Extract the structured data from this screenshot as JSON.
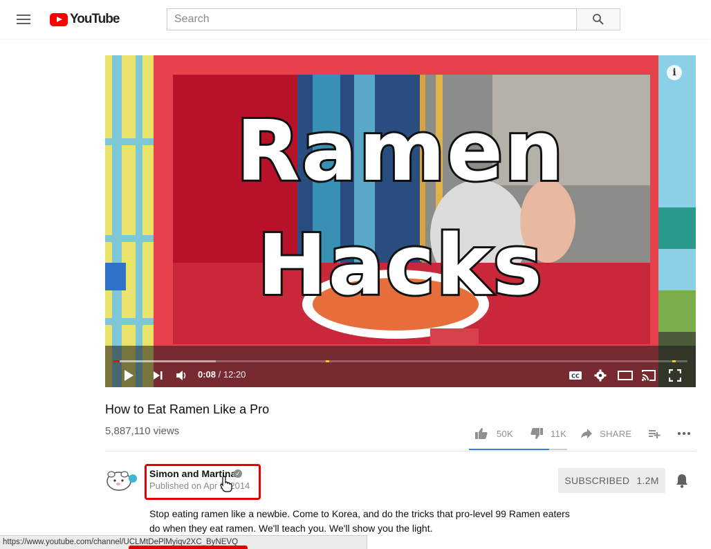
{
  "header": {
    "logo_text": "YouTube",
    "search_placeholder": "Search"
  },
  "player": {
    "overlay_line1": "Ramen",
    "overlay_line2": "Hacks",
    "info_label": "i",
    "current_time": "0:08",
    "time_separator": " / ",
    "duration": "12:20",
    "played_fraction": 0.011,
    "loaded_fraction": 0.178
  },
  "video": {
    "title": "How to Eat Ramen Like a Pro",
    "views": "5,887,110 views",
    "likes": "50K",
    "dislikes": "11K",
    "share_label": "SHARE"
  },
  "channel": {
    "name": "Simon and Martina",
    "published": "Published on Apr 2, 2014",
    "subscribe_label": "SUBSCRIBED",
    "subscriber_count": "1.2M"
  },
  "description": {
    "line1": "Stop eating ramen like a newbie.  Come to Korea, and do the tricks that pro-level 99 Ramen eaters",
    "line2": "do when they eat ramen.  We'll teach you.  We'll show you the light."
  },
  "status_bar": {
    "url": "https://www.youtube.com/channel/UCLMtDePlMyiqv2XC_ByNEVQ"
  },
  "colors": {
    "brand_red": "#ff0000",
    "highlight_red": "#e40000",
    "like_bar_blue": "#2b7de1"
  }
}
